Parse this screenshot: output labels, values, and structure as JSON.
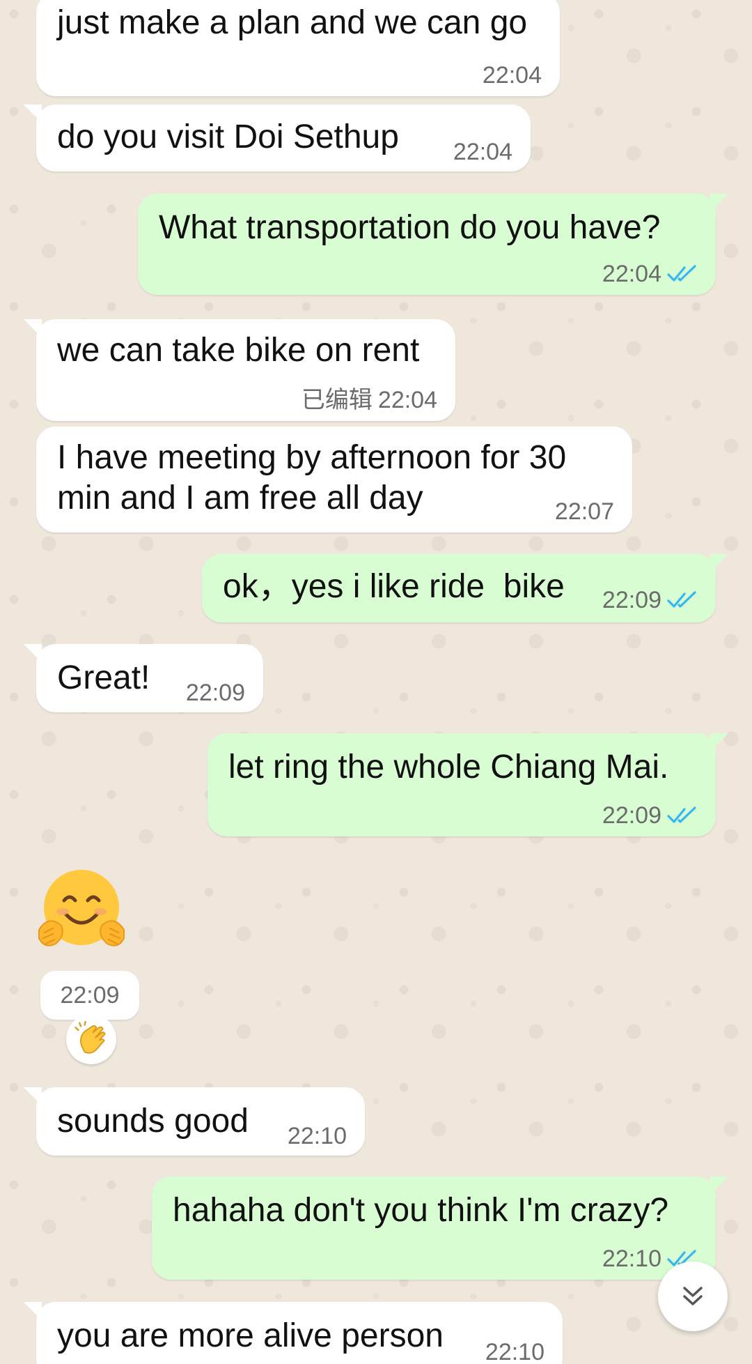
{
  "colors": {
    "background": "#efe7dc",
    "incoming_bubble": "#ffffff",
    "outgoing_bubble": "#d9fdd3",
    "read_tick": "#34b7f1",
    "meta_text": "#6b6b6b"
  },
  "messages": [
    {
      "id": "m1",
      "direction": "in",
      "text": "just make a plan and we can go",
      "time": "22:04"
    },
    {
      "id": "m2",
      "direction": "in",
      "text": "do you visit Doi Sethup",
      "time": "22:04"
    },
    {
      "id": "m3",
      "direction": "out",
      "text": "What transportation do you have?",
      "time": "22:04",
      "status": "read"
    },
    {
      "id": "m4",
      "direction": "in",
      "text": "we can take bike on rent",
      "time": "22:04",
      "edited_label": "已编辑"
    },
    {
      "id": "m5",
      "direction": "in",
      "text": "I have meeting by afternoon for 30\nmin and I am free all day",
      "time": "22:07"
    },
    {
      "id": "m6",
      "direction": "out",
      "text": "ok，yes i like ride  bike",
      "time": "22:09",
      "status": "read"
    },
    {
      "id": "m7",
      "direction": "in",
      "text": "Great!",
      "time": "22:09"
    },
    {
      "id": "m8",
      "direction": "out",
      "text": "let ring the whole Chiang Mai.",
      "time": "22:09",
      "status": "read"
    },
    {
      "id": "m9",
      "direction": "in",
      "type": "emoji",
      "emoji": "hugging-face",
      "time": "22:09",
      "reaction": "clapping-hands"
    },
    {
      "id": "m10",
      "direction": "in",
      "text": "sounds good",
      "time": "22:10"
    },
    {
      "id": "m11",
      "direction": "out",
      "text": "hahaha don't you think I'm crazy?",
      "time": "22:10",
      "status": "read"
    },
    {
      "id": "m12",
      "direction": "in",
      "text": "you are more alive person",
      "time": "22:10"
    }
  ],
  "controls": {
    "scroll_down_icon": "double-chevron-down-icon"
  }
}
